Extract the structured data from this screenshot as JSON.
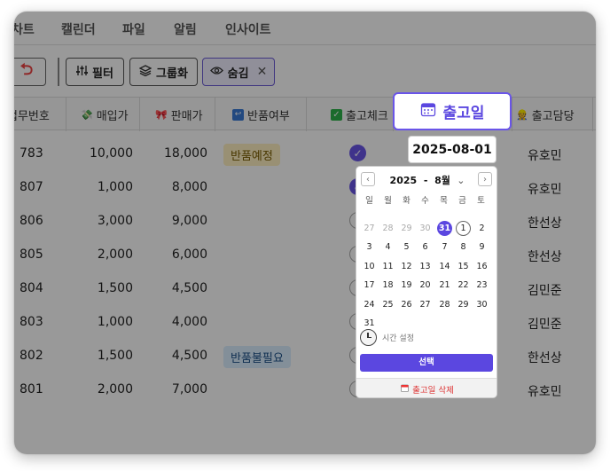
{
  "nav": {
    "tabs": [
      "차트",
      "캘린더",
      "파일",
      "알림",
      "인사이트"
    ]
  },
  "toolbar": {
    "filter_label": "필터",
    "group_label": "그룹화",
    "hide_label": "숨김"
  },
  "table": {
    "headers": {
      "order_no": "업무번호",
      "purchase_price": "매입가",
      "sale_price": "판매가",
      "return_status": "반품여부",
      "shipping_check": "출고체크",
      "ship_date": "출고일",
      "ship_manager": "출고담당"
    },
    "rows": [
      {
        "order_no": "783",
        "purchase": "10,000",
        "sale": "18,000",
        "return_status": "반품예정",
        "checked": true,
        "manager": "유호민"
      },
      {
        "order_no": "807",
        "purchase": "1,000",
        "sale": "8,000",
        "return_status": "",
        "checked": true,
        "manager": "유호민"
      },
      {
        "order_no": "806",
        "purchase": "3,000",
        "sale": "9,000",
        "return_status": "",
        "checked": false,
        "manager": "한선상"
      },
      {
        "order_no": "805",
        "purchase": "2,000",
        "sale": "6,000",
        "return_status": "",
        "checked": false,
        "manager": "한선상"
      },
      {
        "order_no": "804",
        "purchase": "1,500",
        "sale": "4,500",
        "return_status": "",
        "checked": false,
        "manager": "김민준"
      },
      {
        "order_no": "803",
        "purchase": "1,000",
        "sale": "4,000",
        "return_status": "",
        "checked": false,
        "manager": "김민준"
      },
      {
        "order_no": "802",
        "purchase": "1,500",
        "sale": "4,500",
        "return_status": "반품불필요",
        "checked": false,
        "manager": "한선상"
      },
      {
        "order_no": "801",
        "purchase": "2,000",
        "sale": "7,000",
        "return_status": "",
        "checked": false,
        "manager": "유호민"
      }
    ]
  },
  "date_chip": {
    "label": "출고일"
  },
  "date_picker": {
    "value": "2025-08-01",
    "year": "2025",
    "separator": "-",
    "month": "8월",
    "weekdays": [
      "일",
      "월",
      "화",
      "수",
      "목",
      "금",
      "토"
    ],
    "weeks": [
      [
        "27",
        "28",
        "29",
        "30",
        "31",
        "1",
        "2"
      ],
      [
        "3",
        "4",
        "5",
        "6",
        "7",
        "8",
        "9"
      ],
      [
        "10",
        "11",
        "12",
        "13",
        "14",
        "15",
        "16"
      ],
      [
        "17",
        "18",
        "19",
        "20",
        "21",
        "22",
        "23"
      ],
      [
        "24",
        "25",
        "26",
        "27",
        "28",
        "29",
        "30"
      ],
      [
        "31"
      ]
    ],
    "time_label": "시간 설정",
    "select_label": "선택",
    "delete_label": "출고일 삭제"
  },
  "colors": {
    "accent": "#5b47e0",
    "badge_warn": "#fff1c2",
    "badge_info": "#dbeeff"
  }
}
